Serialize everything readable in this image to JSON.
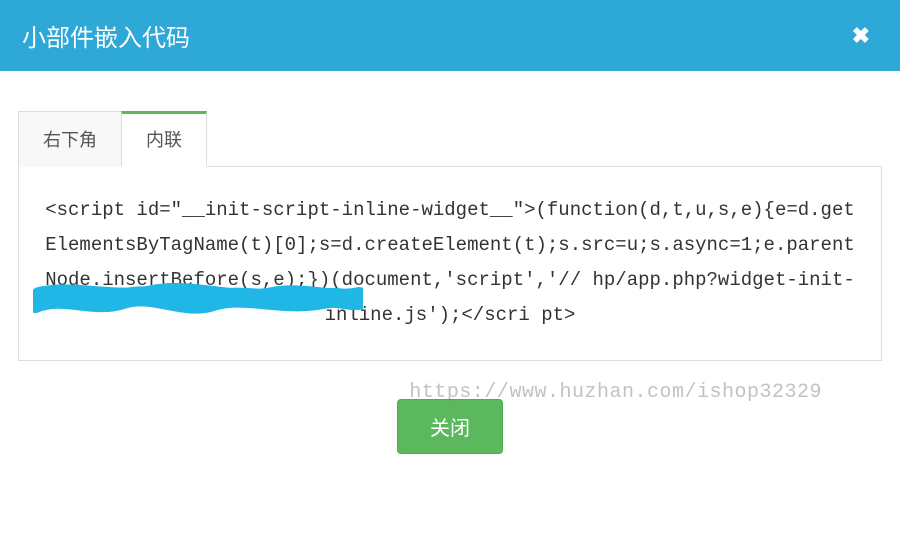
{
  "header": {
    "title": "小部件嵌入代码",
    "close_symbol": "✖"
  },
  "tabs": {
    "items": [
      {
        "label": "右下角",
        "active": false
      },
      {
        "label": "内联",
        "active": true
      }
    ]
  },
  "code": {
    "text": "<script id=\"__init-script-inline-widget__\">(function(d,t,u,s,e){e=d.getElementsByTagName(t)[0];s=d.createElement(t);s.src=u;s.async=1;e.parentNode.insertBefore(s,e);})(document,'script','//                          hp/app.php?widget-init-inline.js');</scri pt>"
  },
  "footer": {
    "close_label": "关闭"
  },
  "watermark": {
    "text": "https://www.huzhan.com/ishop32329"
  }
}
